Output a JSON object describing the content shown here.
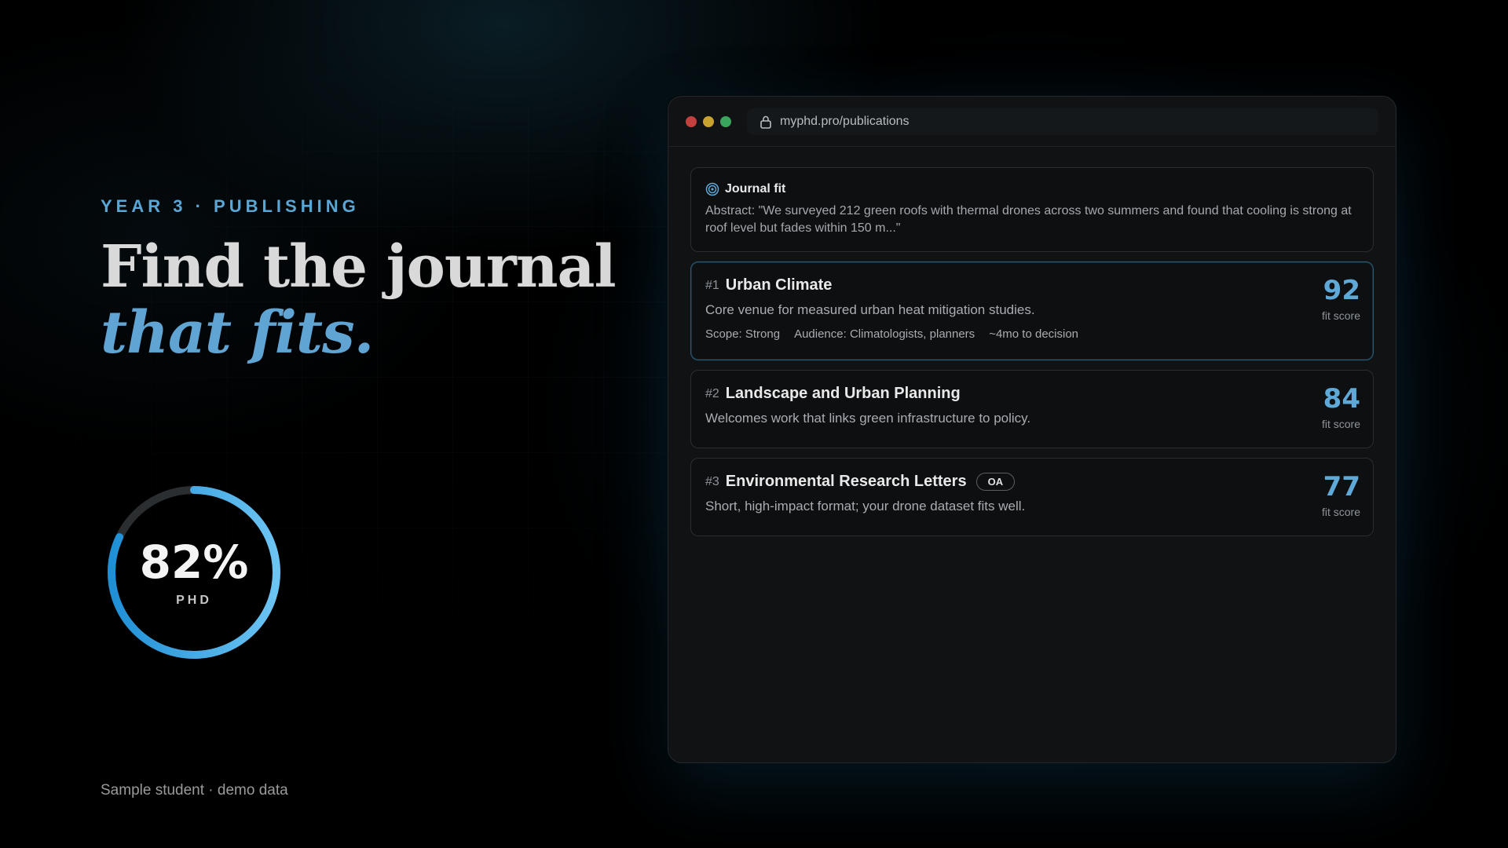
{
  "hero": {
    "eyebrow": "YEAR 3 · PUBLISHING",
    "headline_line1": "Find the journal",
    "headline_line2": "that fits.",
    "progress": {
      "value_text": "82%",
      "value": 0.82,
      "label": "PHD"
    },
    "footnote": "Sample student · demo data"
  },
  "browser": {
    "url": "myphd.pro/publications",
    "fit_card": {
      "title": "Journal fit",
      "abstract": "Abstract: \"We surveyed 212 green roofs with thermal drones across two summers and found that cooling is strong at roof level but fades within 150 m...\""
    },
    "journals": [
      {
        "rank": "#1",
        "name": "Urban Climate",
        "description": "Core venue for measured urban heat mitigation studies.",
        "meta": [
          "Scope: Strong",
          "Audience: Climatologists, planners",
          "~4mo to decision"
        ],
        "score": "92",
        "score_label": "fit score"
      },
      {
        "rank": "#2",
        "name": "Landscape and Urban Planning",
        "description": "Welcomes work that links green infrastructure to policy.",
        "score": "84",
        "score_label": "fit score"
      },
      {
        "rank": "#3",
        "name": "Environmental Research Letters",
        "badge": "OA",
        "description": "Short, high-impact format; your drone dataset fits well.",
        "score": "77",
        "score_label": "fit score"
      }
    ]
  },
  "colors": {
    "accent": "#5fa9d8",
    "ring_start": "#1f8fd6",
    "ring_end": "#6cc4f2",
    "dot_red": "#c2403d",
    "dot_yellow": "#c9a22f",
    "dot_green": "#3aa55c"
  }
}
